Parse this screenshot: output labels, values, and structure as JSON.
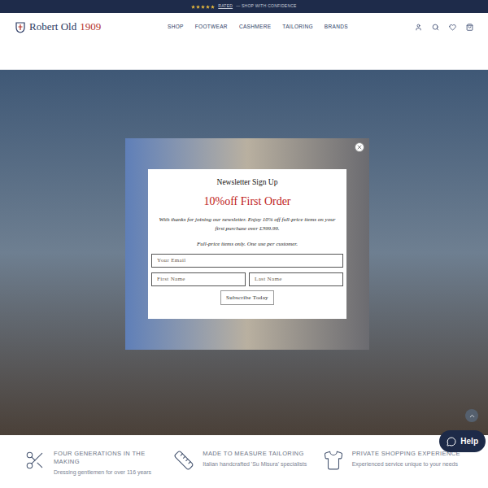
{
  "announcement": {
    "stars": 5,
    "link": "RATED",
    "text": "— SHOP WITH CONFIDENCE"
  },
  "logo": {
    "name": "Robert Old",
    "year": "1909"
  },
  "nav": [
    {
      "label": "SHOP"
    },
    {
      "label": "FOOTWEAR"
    },
    {
      "label": "CASHMERE"
    },
    {
      "label": "TAILORING"
    },
    {
      "label": "BRANDS"
    }
  ],
  "popup": {
    "title": "Newsletter Sign Up",
    "offer": "10%off First Order",
    "body": "With thanks for joining our newsletter. Enjoy 10% off full-price items on your first purchase over £399.99.",
    "note": "Full-price items only. One use per customer.",
    "fields": [
      {
        "placeholder": "Your Email"
      },
      {
        "placeholder": "First Name"
      },
      {
        "placeholder": "Last Name"
      }
    ],
    "button": "Subscribe Today"
  },
  "features": [
    {
      "title": "FOUR GENERATIONS IN THE MAKING",
      "text": "Dressing gentlemen for over 116 years"
    },
    {
      "title": "MADE TO MEASURE TAILORING",
      "text": "Italian handcrafted 'Su Misura' specialists"
    },
    {
      "title": "PRIVATE SHOPPING EXPERIENCE",
      "text": "Experienced service unique to your needs"
    }
  ],
  "help": {
    "label": "Help"
  }
}
